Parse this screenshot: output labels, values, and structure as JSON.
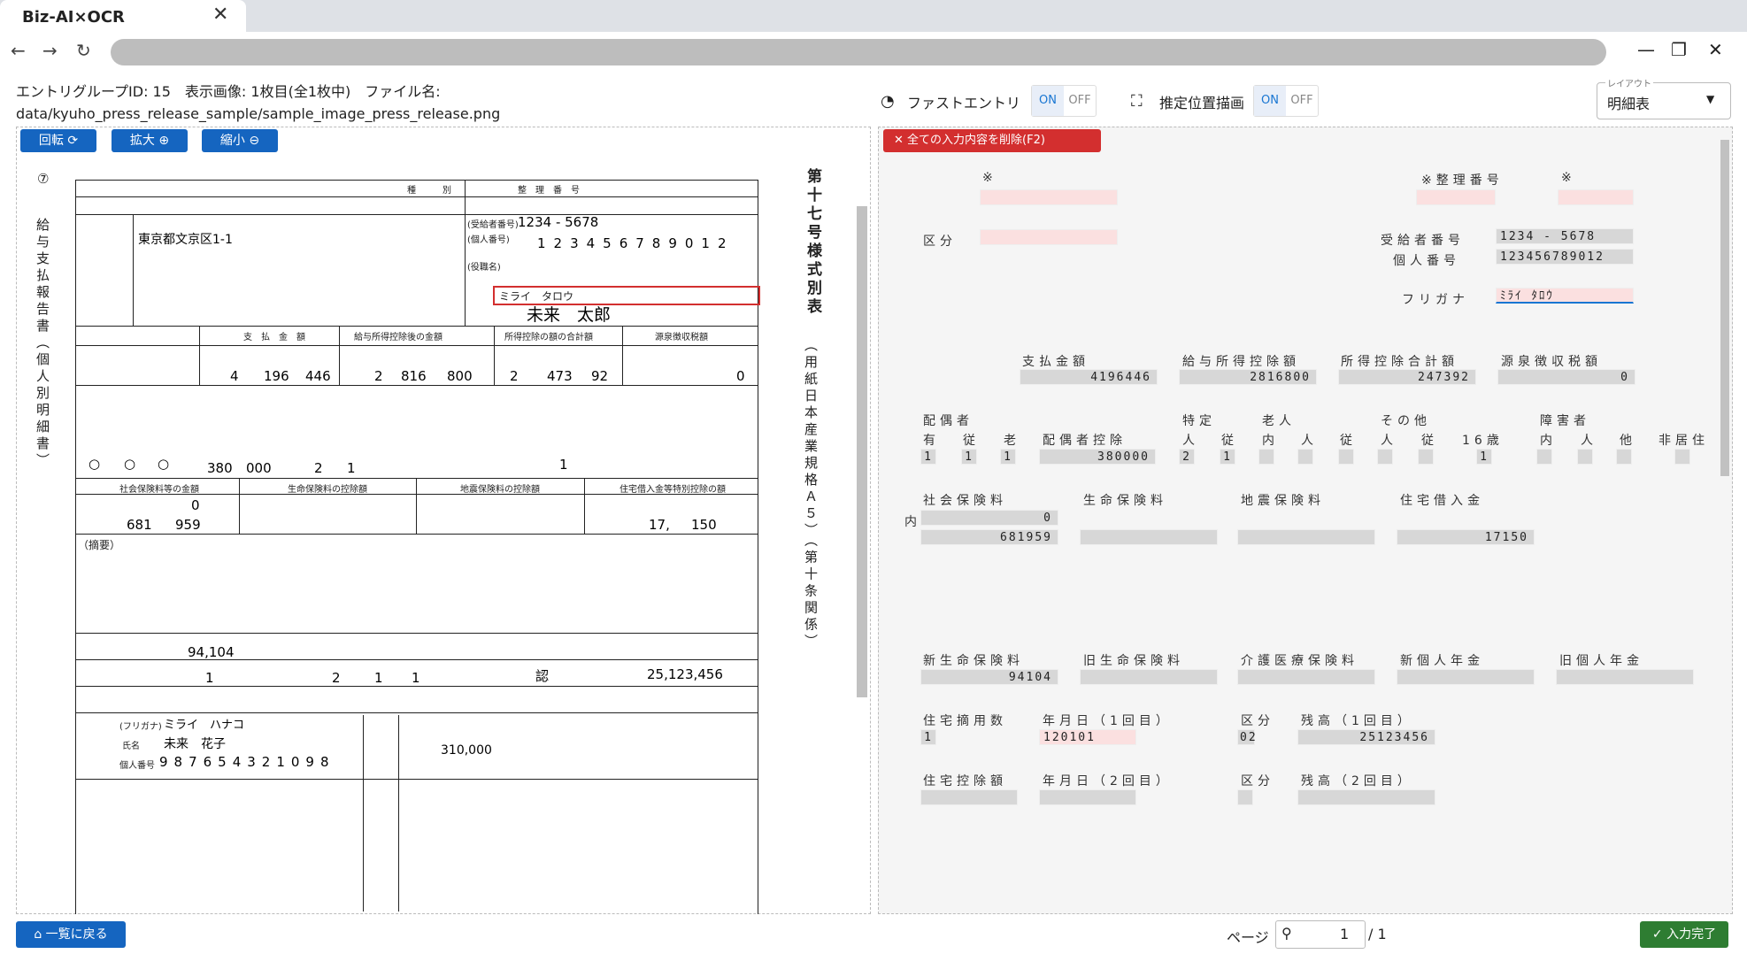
{
  "browser": {
    "tab_title": "Biz-AI×OCR"
  },
  "header": {
    "info_line1": "エントリグループID: 15　表示画像: 1枚目(全1枚中)　ファイル名:",
    "info_line2": "data/kyuho_press_release_sample/sample_image_press_release.png",
    "fast_entry_label": "ファストエントリ",
    "estimate_label": "推定位置描画",
    "on": "ON",
    "off": "OFF",
    "layout_caption": "レイアウト",
    "layout_value": "明細表"
  },
  "left_toolbar": {
    "rotate": "回転",
    "zoom_in": "拡大",
    "zoom_out": "縮小"
  },
  "document": {
    "circle_num": "⑦",
    "left_vertical": "給与支払報告書（個人別明細書）",
    "right_vertical": "第十七号様式別表",
    "right_vertical2": "（用紙日本産業規格Ａ５）（第十条関係）",
    "recipient_no": "1234 - 5678",
    "personal_no": [
      "1",
      "2",
      "3",
      "4",
      "5",
      "6",
      "7",
      "8",
      "9",
      "0",
      "1",
      "2"
    ],
    "address": "東京都文京区1-1",
    "furigana": "ミライ　タロウ",
    "name": "未来　太郎",
    "pay_amount": [
      "4",
      "196",
      "446"
    ],
    "deduction_after": [
      "2",
      "816",
      "800"
    ],
    "deduction_total": [
      "2",
      "473",
      "92"
    ],
    "tax": "0",
    "spouse_marks": [
      "○",
      "○",
      "○"
    ],
    "spouse_ded": [
      "380",
      "000"
    ],
    "dep_nums": [
      "2",
      "1"
    ],
    "dep16": "1",
    "ins_social": [
      "0",
      "681",
      "959"
    ],
    "housing_ded": [
      "17,",
      "150"
    ],
    "summary_label": "（摘要）",
    "new_life": "94,104",
    "housing_count": "1",
    "date_parts": [
      "2",
      "1",
      "1"
    ],
    "nintei": "認",
    "loan_balance": "25,123,456",
    "spouse_furigana": "ミライ　ハナコ",
    "spouse_name": "未来　花子",
    "spouse_no": [
      "9",
      "8",
      "7",
      "6",
      "5",
      "4",
      "3",
      "2",
      "1",
      "0",
      "9",
      "8"
    ],
    "spouse_income": "310,000",
    "labels": {
      "kubun": "種　　　別",
      "seiri": "整　理　番　号",
      "shiharai": "支　払　金　額",
      "kyuyo": "給与所得控除後の金額",
      "koujo": "所得控除の額の合計額",
      "gensen": "源泉徴収税額",
      "furigana_tag": "(フリガナ)",
      "shimei": "氏名",
      "kojin": "個人番号",
      "jukyu": "(受給者番号)",
      "kojin_tag": "(個人番号)",
      "yakushoku": "(役職名)",
      "shakai": "社会保険料等の金額",
      "seimei": "生命保険料の控除額",
      "jishin": "地震保険料の控除額",
      "jutaku": "住宅借入金等特別控除の額"
    }
  },
  "right_form": {
    "delete_all": "全ての入力内容を削除(F2)",
    "asterisk": "※",
    "seiri_label": "※整理番号",
    "kubun": "区分",
    "jukyu_label": "受給者番号",
    "jukyu_val": "1234 - 5678",
    "kojin_label": "個人番号",
    "kojin_val": "123456789012",
    "furigana_label": "フリガナ",
    "furigana_val": "ﾐﾗｲ ﾀﾛｳ",
    "pay_labels": [
      "支払金額",
      "給与所得控除額",
      "所得控除合計額",
      "源泉徴収税額"
    ],
    "pay_values": [
      "4196446",
      "2816800",
      "247392",
      "0"
    ],
    "spouse_label": "配偶者",
    "spouse_sub": [
      "有",
      "従",
      "老"
    ],
    "spouse_ded_label": "配偶者控除",
    "tokutei": "特定",
    "roujin": "老人",
    "sonota": "その他",
    "sixteen": "16歳",
    "shougai": "障害者",
    "hikyo": "非居住",
    "sub_labels": [
      "人",
      "従",
      "内",
      "人",
      "従",
      "人",
      "従",
      "内",
      "人",
      "他"
    ],
    "spouse_vals": [
      "1",
      "1",
      "1"
    ],
    "spouse_ded_val": "380000",
    "tokutei_vals": [
      "2",
      "1"
    ],
    "sixteen_val": "1",
    "ins_labels": [
      "社会保険料",
      "生命保険料",
      "地震保険料",
      "住宅借入金"
    ],
    "uchi": "内",
    "ins_uchi_val": "0",
    "ins_social_val": "681959",
    "housing_val": "17150",
    "life_labels": [
      "新生命保険料",
      "旧生命保険料",
      "介護医療保険料",
      "新個人年金",
      "旧個人年金"
    ],
    "new_life_val": "94104",
    "jutaku_count_label": "住宅摘用数",
    "date1_label": "年月日（1回目）",
    "kubun_label": "区分",
    "zan1_label": "残高（1回目）",
    "jutaku_count_val": "1",
    "date1_val": "120101",
    "kubun_val": "02",
    "zan1_val": "25123456",
    "jutaku_ded_label": "住宅控除額",
    "date2_label": "年月日（2回目）",
    "zan2_label": "残高（2回目）"
  },
  "footer": {
    "back": "一覧に戻る",
    "page_label": "ページ",
    "page_value": "1",
    "page_total": "/ 1",
    "complete": "入力完了"
  }
}
